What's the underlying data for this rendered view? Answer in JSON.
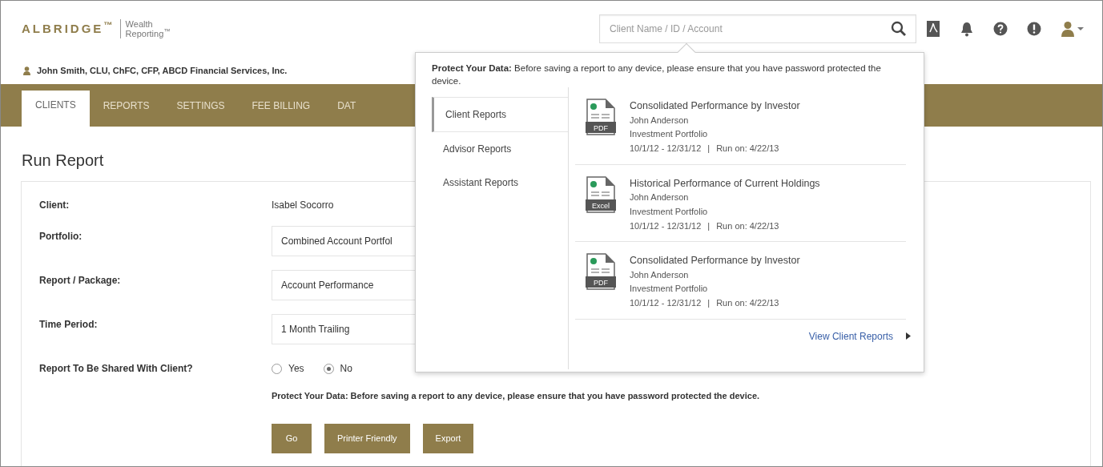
{
  "header": {
    "brand": "ALBRIDGE$^{™}$",
    "product": [
      "Wealth",
      "Reporting$^{™}$"
    ],
    "search": {
      "placeholder": "Client Name / ID / Account"
    }
  },
  "user_line": "John Smith, CLU, ChFC, CFP, ABCD Financial Services, Inc.",
  "nav_tabs": [
    {
      "label": "CLIENTS",
      "selected": true
    },
    {
      "label": "REPORTS",
      "selected": false
    },
    {
      "label": "SETTINGS",
      "selected": false
    },
    {
      "label": "FEE BILLING",
      "selected": false
    },
    {
      "label": "DAT",
      "selected": false
    }
  ],
  "page_title": "Run Report",
  "form": {
    "rows": [
      {
        "kind": "text",
        "label": "Client:",
        "value": "Isabel Socorro"
      },
      {
        "kind": "select",
        "label": "Portfolio:",
        "value": "Combined Account Portfol"
      },
      {
        "kind": "select",
        "label": "Report / Package:",
        "value": "Account Performance"
      },
      {
        "kind": "select",
        "label": "Time Period:",
        "value": "1 Month Trailing"
      },
      {
        "kind": "radio",
        "label": "Report To Be Shared With Client?",
        "options": [
          {
            "label": "Yes",
            "selected": false
          },
          {
            "label": "No",
            "selected": true
          }
        ]
      }
    ],
    "notice": "**Protect Your Data:** Before saving a report to any device, please ensure that you have password protected the device.",
    "buttons": [
      "Go",
      "Printer Friendly",
      "Export"
    ]
  },
  "reports_popover": {
    "notice": "**Protect Your Data:** Before saving a report to any device, please ensure that you have password protected the device.",
    "tabs": [
      {
        "label": "Client Reports",
        "selected": true
      },
      {
        "label": "Advisor Reports",
        "selected": false
      },
      {
        "label": "Assistant Reports",
        "selected": false
      }
    ],
    "reports": [
      {
        "file_type": "PDF",
        "title": "Consolidated Performance by Investor",
        "client": "John Anderson",
        "portfolio": "Investment Portfolio",
        "dates": "10/1/12 - 12/31/12",
        "separator": "|",
        "run_on": "Run on: 4/22/13"
      },
      {
        "file_type": "Excel",
        "title": "Historical Performance of Current Holdings",
        "client": "John Anderson",
        "portfolio": "Investment Portfolio",
        "dates": "10/1/12 - 12/31/12",
        "separator": "|",
        "run_on": "Run on: 4/22/13"
      },
      {
        "file_type": "PDF",
        "title": "Consolidated Performance by Investor",
        "client": "John Anderson",
        "portfolio": "Investment Portfolio",
        "dates": "10/1/12 - 12/31/12",
        "separator": "|",
        "run_on": "Run on: 4/22/13"
      }
    ],
    "link": "View Client Reports"
  }
}
